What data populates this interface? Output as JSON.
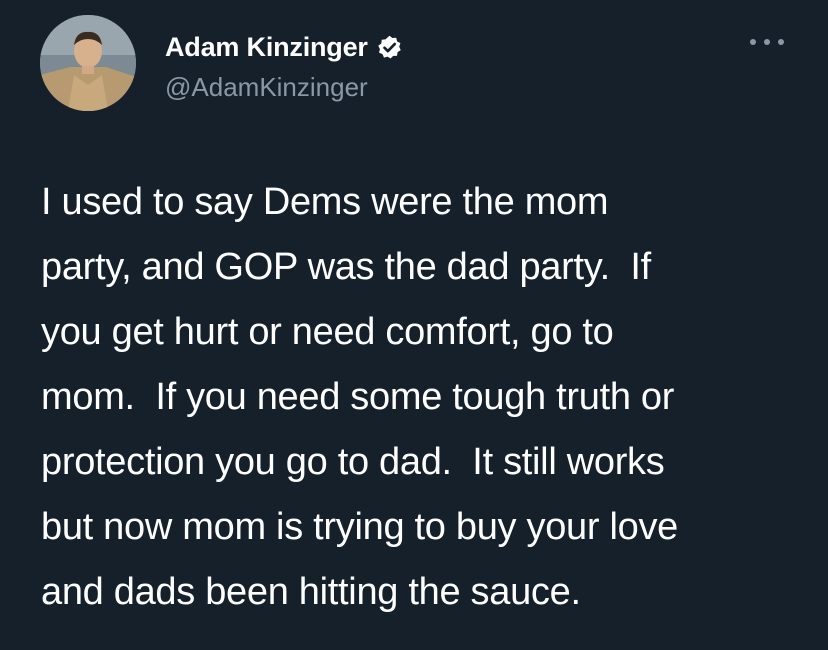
{
  "author": {
    "display_name": "Adam Kinzinger",
    "handle": "@AdamKinzinger",
    "verified": true,
    "avatar_icon": "profile-photo-icon",
    "verified_icon": "verified-badge-icon"
  },
  "more_icon": "more-options-icon",
  "tweet": {
    "lines": [
      "I used to say Dems were the mom",
      "party, and GOP was the dad party.  If",
      "you get hurt or need comfort, go to",
      "mom.  If you need some tough truth or",
      "protection you go to dad.  It still works",
      "but now mom is trying to buy your love",
      "and dads been hitting the sauce."
    ]
  },
  "colors": {
    "background": "#15202b",
    "primary_text": "#ffffff",
    "secondary_text": "#8b98a5"
  }
}
